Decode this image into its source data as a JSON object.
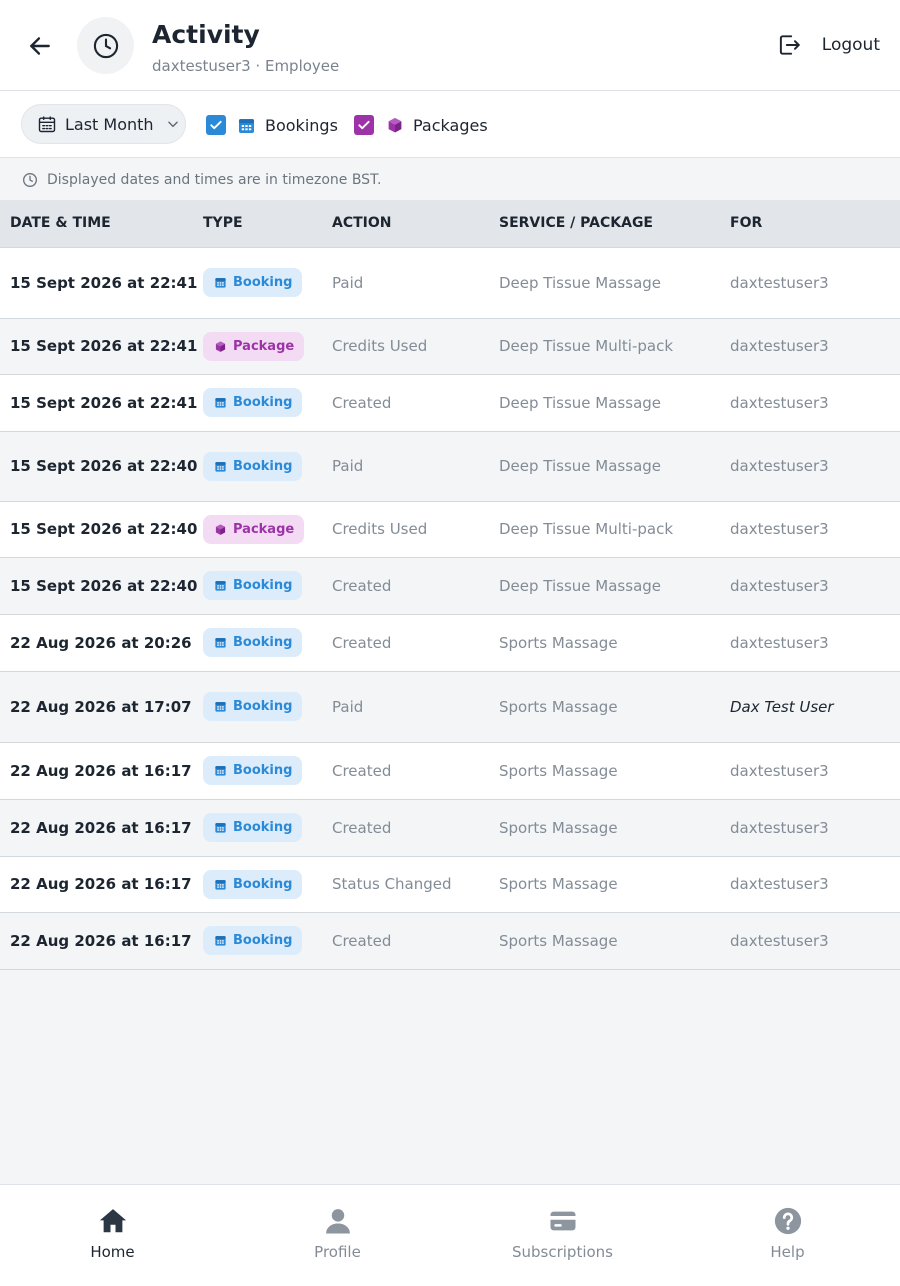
{
  "header": {
    "title": "Activity",
    "subtitle": "daxtestuser3 · Employee",
    "logout_label": "Logout"
  },
  "filters": {
    "period_label": "Last Month",
    "bookings": {
      "label": "Bookings",
      "checked": true
    },
    "packages": {
      "label": "Packages",
      "checked": true
    }
  },
  "timezone_note": "Displayed dates and times are in timezone BST.",
  "table": {
    "columns": [
      "DATE & TIME",
      "TYPE",
      "ACTION",
      "SERVICE / PACKAGE",
      "FOR"
    ],
    "rows": [
      {
        "date": "15 Sept 2026 at 22:41",
        "type": "Booking",
        "action": "Paid",
        "service": "Deep Tissue Massage",
        "for": "daxtestuser3"
      },
      {
        "date": "15 Sept 2026 at 22:41",
        "type": "Package",
        "action": "Credits Used",
        "service": "Deep Tissue Multi-pack",
        "for": "daxtestuser3"
      },
      {
        "date": "15 Sept 2026 at 22:41",
        "type": "Booking",
        "action": "Created",
        "service": "Deep Tissue Massage",
        "for": "daxtestuser3"
      },
      {
        "date": "15 Sept 2026 at 22:40",
        "type": "Booking",
        "action": "Paid",
        "service": "Deep Tissue Massage",
        "for": "daxtestuser3"
      },
      {
        "date": "15 Sept 2026 at 22:40",
        "type": "Package",
        "action": "Credits Used",
        "service": "Deep Tissue Multi-pack",
        "for": "daxtestuser3"
      },
      {
        "date": "15 Sept 2026 at 22:40",
        "type": "Booking",
        "action": "Created",
        "service": "Deep Tissue Massage",
        "for": "daxtestuser3"
      },
      {
        "date": "22 Aug 2026 at 20:26",
        "type": "Booking",
        "action": "Created",
        "service": "Sports Massage",
        "for": "daxtestuser3"
      },
      {
        "date": "22 Aug 2026 at 17:07",
        "type": "Booking",
        "action": "Paid",
        "service": "Sports Massage",
        "for": "Dax Test User",
        "for_italic": true
      },
      {
        "date": "22 Aug 2026 at 16:17",
        "type": "Booking",
        "action": "Created",
        "service": "Sports Massage",
        "for": "daxtestuser3"
      },
      {
        "date": "22 Aug 2026 at 16:17",
        "type": "Booking",
        "action": "Created",
        "service": "Sports Massage",
        "for": "daxtestuser3"
      },
      {
        "date": "22 Aug 2026 at 16:17",
        "type": "Booking",
        "action": "Status Changed",
        "service": "Sports Massage",
        "for": "daxtestuser3"
      },
      {
        "date": "22 Aug 2026 at 16:17",
        "type": "Booking",
        "action": "Created",
        "service": "Sports Massage",
        "for": "daxtestuser3"
      }
    ]
  },
  "nav": {
    "items": [
      {
        "label": "Home",
        "icon": "home-icon",
        "active": true
      },
      {
        "label": "Profile",
        "icon": "profile-icon",
        "active": false
      },
      {
        "label": "Subscriptions",
        "icon": "card-icon",
        "active": false
      },
      {
        "label": "Help",
        "icon": "help-icon",
        "active": false
      }
    ]
  },
  "colors": {
    "booking_accent": "#2b8ad8",
    "package_accent": "#9d33a8",
    "checkbox_bookings": "#2b8ad8",
    "checkbox_packages": "#9d33a8"
  }
}
